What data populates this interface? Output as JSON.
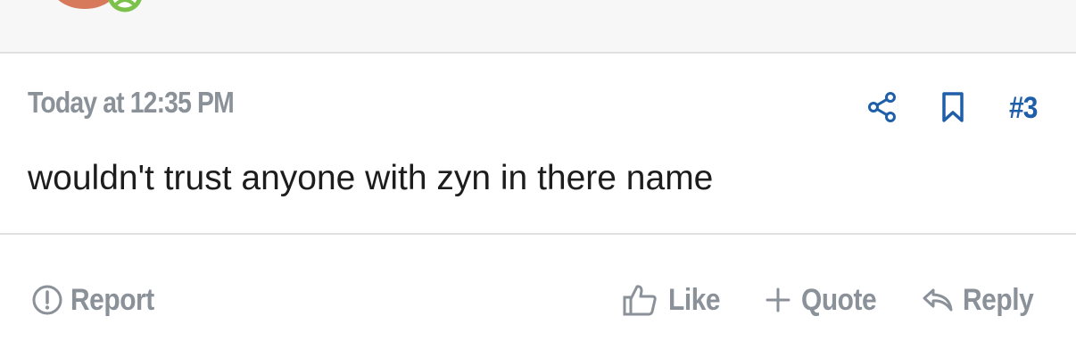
{
  "post": {
    "timestamp": "Today at 12:35 PM",
    "number": "#3",
    "message": "wouldn't trust anyone with zyn in there name"
  },
  "actions": {
    "share_icon": "share-icon",
    "bookmark_icon": "bookmark-icon"
  },
  "footer": {
    "report_label": "Report",
    "like_label": "Like",
    "quote_label": "Quote",
    "reply_label": "Reply"
  },
  "colors": {
    "accent": "#1f5ea8",
    "muted": "#8a9199",
    "text": "#1d1d1d",
    "status_green": "#7cc24a",
    "avatar": "#d77a5c"
  }
}
